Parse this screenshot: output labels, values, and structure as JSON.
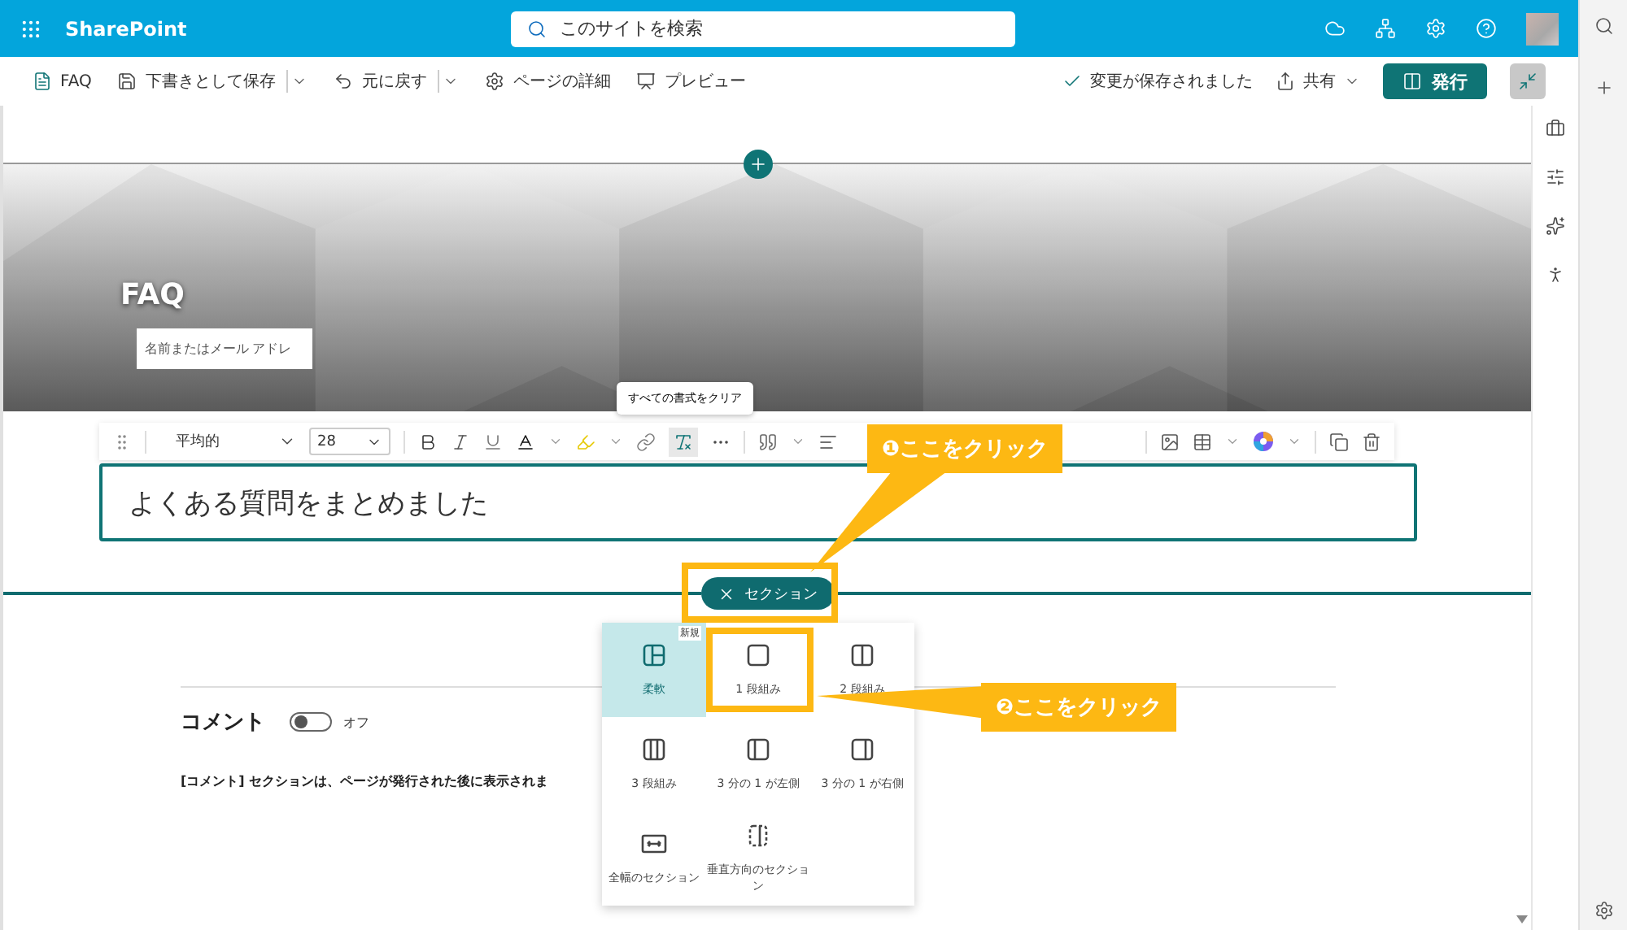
{
  "app": {
    "name": "SharePoint"
  },
  "search": {
    "placeholder": "このサイトを検索"
  },
  "command_bar": {
    "items": [
      {
        "kind": "page",
        "label": "FAQ",
        "dropdown": false
      },
      {
        "kind": "save",
        "label": "下書きとして保存",
        "dropdown": true
      },
      {
        "kind": "undo",
        "label": "元に戻す",
        "dropdown": true
      },
      {
        "kind": "details",
        "label": "ページの詳細",
        "dropdown": false
      },
      {
        "kind": "preview",
        "label": "プレビュー",
        "dropdown": false
      }
    ],
    "status": "変更が保存されました",
    "share": "共有",
    "publish": "発行"
  },
  "hero": {
    "title": "FAQ",
    "author_placeholder": "名前またはメール アドレ"
  },
  "tooltip": "すべての書式をクリア",
  "format_toolbar": {
    "style": "平均的",
    "font_size": "28"
  },
  "text_box": {
    "value": "よくある質問をまとめました"
  },
  "section_chip": {
    "label": "セクション"
  },
  "layout_menu": {
    "items": [
      {
        "kind": "flexible",
        "label": "柔軟",
        "badge": "新規",
        "selected": true
      },
      {
        "kind": "one",
        "label": "1 段組み",
        "selected": false
      },
      {
        "kind": "two",
        "label": "2 段組み",
        "selected": false
      },
      {
        "kind": "three",
        "label": "3 段組み",
        "selected": false
      },
      {
        "kind": "left",
        "label": "3 分の 1 が左側",
        "selected": false
      },
      {
        "kind": "right",
        "label": "3 分の 1 が右側",
        "selected": false
      },
      {
        "kind": "full",
        "label": "全幅のセクション",
        "selected": false
      },
      {
        "kind": "vertical",
        "label": "垂直方向のセクション",
        "selected": false
      }
    ]
  },
  "comments": {
    "title": "コメント",
    "on": false,
    "state_label": "オフ",
    "note": "[コメント] セクションは、ページが発行された後に表示されま"
  },
  "callouts": [
    {
      "text": "❶ここをクリック"
    },
    {
      "text": "❷ここをクリック"
    }
  ]
}
